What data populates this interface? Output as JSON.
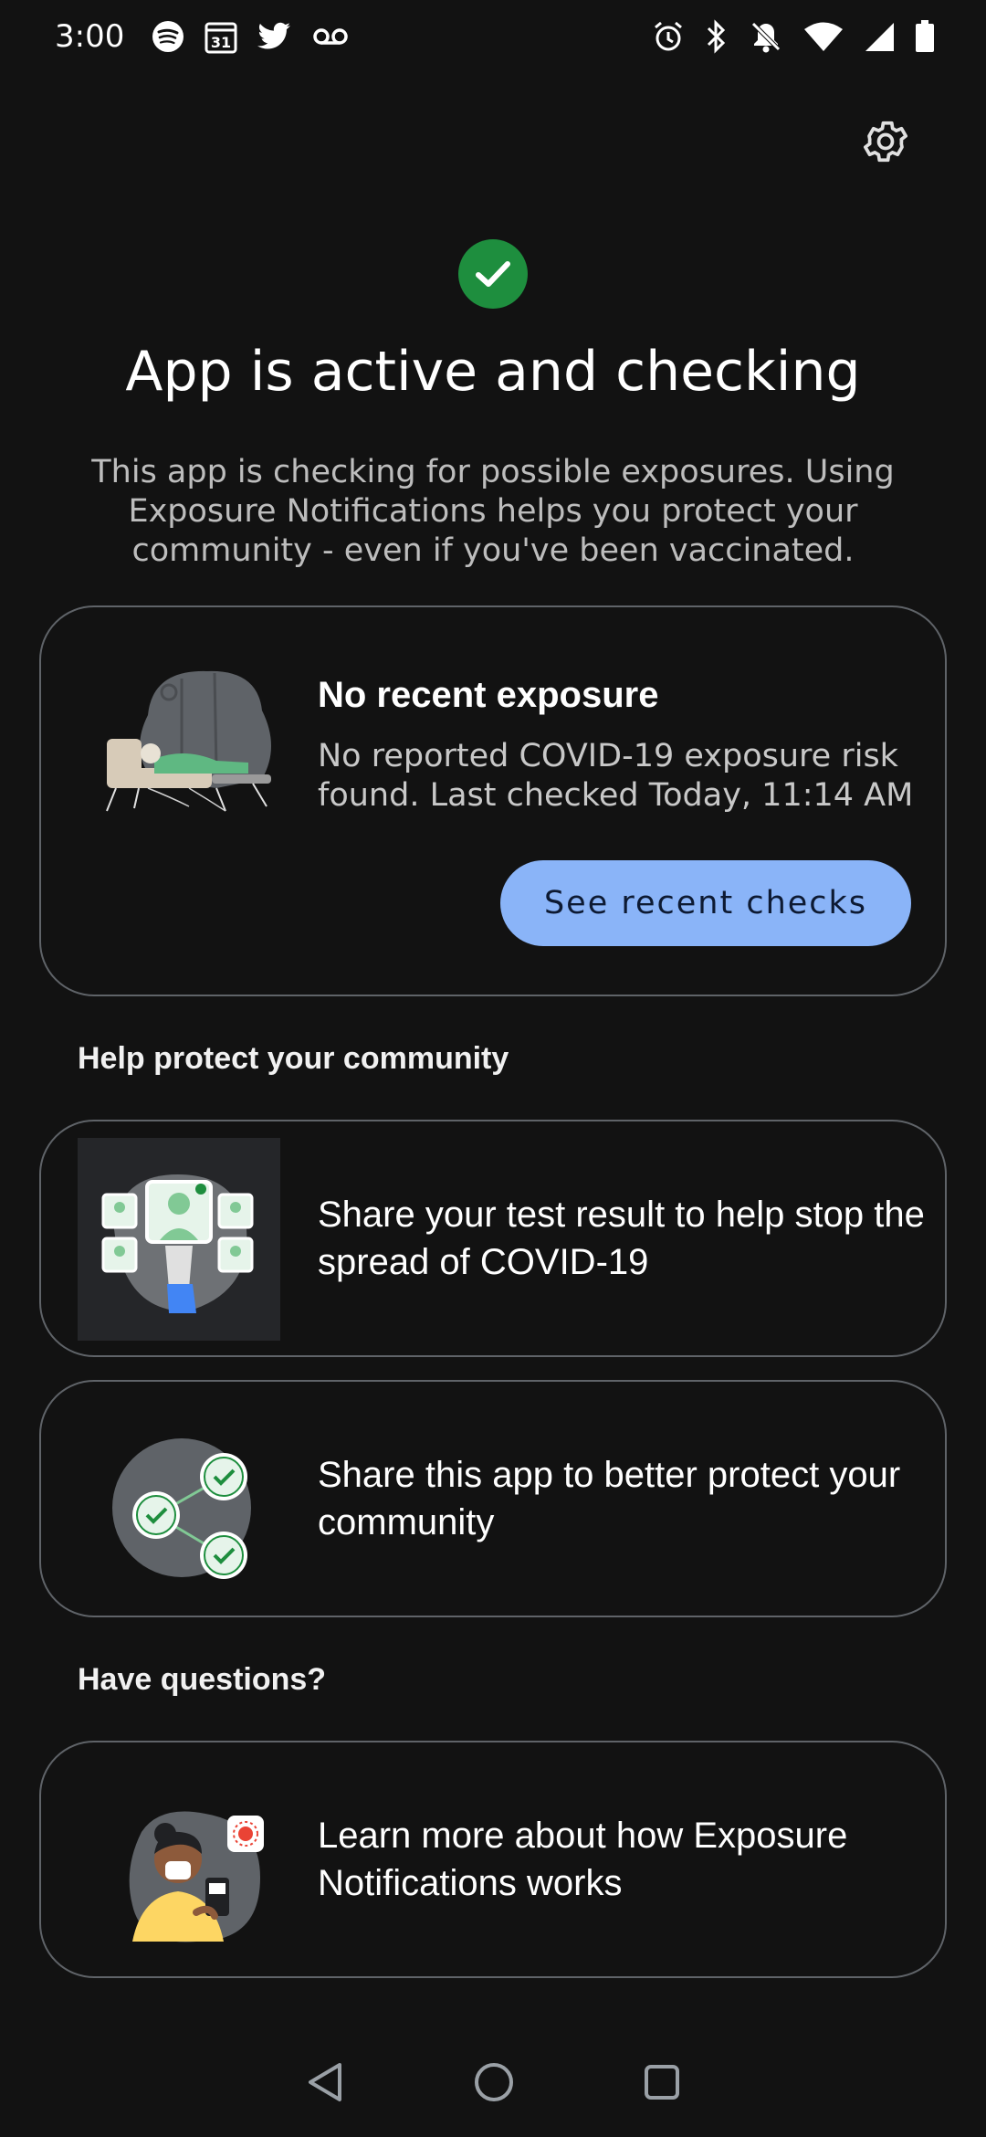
{
  "status_bar": {
    "time": "3:00",
    "left_icons": [
      "spotify-icon",
      "calendar-icon",
      "twitter-icon",
      "voicemail-icon"
    ],
    "calendar_day": "31",
    "right_icons": [
      "alarm-icon",
      "bluetooth-icon",
      "notifications-off-icon",
      "wifi-icon",
      "signal-icon",
      "battery-icon"
    ]
  },
  "header": {
    "settings_icon": "gear-icon"
  },
  "status": {
    "icon": "check-circle-icon",
    "title": "App is active and checking",
    "description": "This app is checking for possible exposures. Using Exposure Notifications helps you protect your community - even if you've been vaccinated."
  },
  "exposure_card": {
    "title": "No recent exposure",
    "description": "No reported COVID-19 exposure risk found. Last checked Today, 11:14 AM",
    "button_label": "See recent checks"
  },
  "sections": {
    "community_heading": "Help protect your community",
    "questions_heading": "Have questions?"
  },
  "cards": {
    "share_result": "Share your test result to help stop the spread of COVID-19",
    "share_app": "Share this app to better protect your community",
    "learn_more": "Learn more about how Exposure Notifications works"
  },
  "nav": {
    "icons": [
      "back-icon",
      "home-icon",
      "recents-icon"
    ]
  },
  "colors": {
    "background": "#121212",
    "accent_button": "#8ab4f8",
    "active_green": "#1e8e3e",
    "card_border": "#5f6368"
  }
}
